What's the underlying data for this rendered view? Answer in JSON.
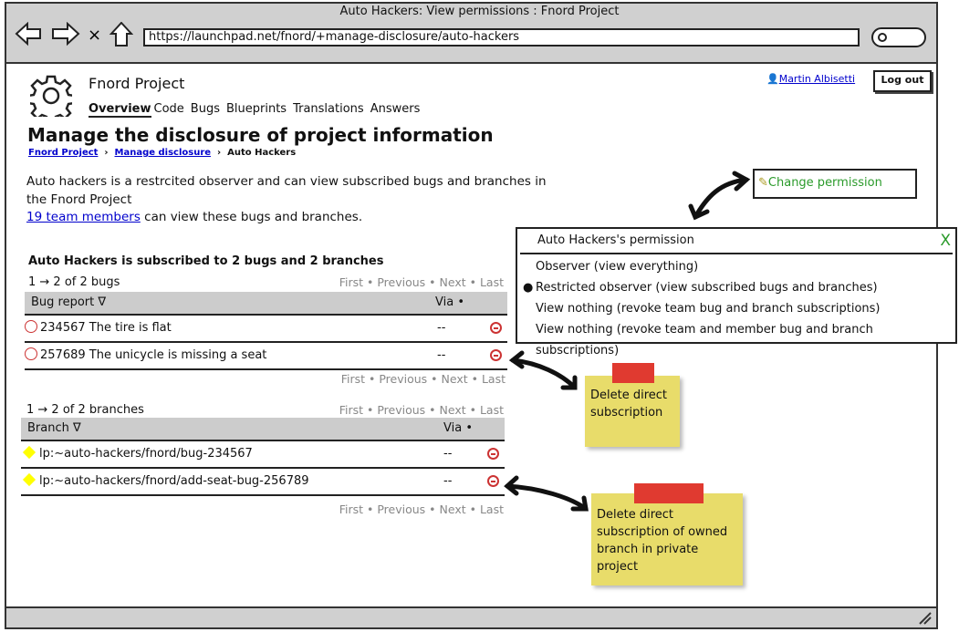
{
  "browser": {
    "title": "Auto Hackers: View permissions : Fnord Project",
    "url": "https://launchpad.net/fnord/+manage-disclosure/auto-hackers",
    "stop": "X"
  },
  "header": {
    "project": "Fnord Project",
    "user": "Martin Albisetti",
    "logout": "Log out",
    "nav": [
      "Overview",
      "Code",
      "Bugs",
      "Blueprints",
      "Translations",
      "Answers"
    ]
  },
  "page": {
    "title": "Manage the disclosure of project information",
    "breadcrumb": [
      "Fnord Project",
      "Manage disclosure",
      "Auto Hackers"
    ],
    "desc1": "Auto hackers is a restrcited observer and can view subscribed bugs and branches in",
    "desc2": "the Fnord Project",
    "members_link": "19 team members",
    "members_rest": " can view these bugs and branches.",
    "change_permission": "Change permission",
    "subs_heading": "Auto Hackers is subscribed to 2 bugs and 2 branches"
  },
  "pager": {
    "first": "First",
    "previous": "Previous",
    "next": "Next",
    "last": "Last",
    "sep": "•"
  },
  "bugs": {
    "count": "1 → 2 of 2 bugs",
    "col1": "Bug report ∇",
    "col2": "Via •",
    "rows": [
      {
        "title": "234567 The tire is flat",
        "via": "--"
      },
      {
        "title": "257689 The unicycle is missing a seat",
        "via": "--"
      }
    ]
  },
  "branches": {
    "count": "1 → 2 of 2 branches",
    "col1": "Branch ∇",
    "col2": "Via •",
    "rows": [
      {
        "title": "lp:~auto-hackers/fnord/bug-234567",
        "via": "--"
      },
      {
        "title": "lp:~auto-hackers/fnord/add-seat-bug-256789",
        "via": "--"
      }
    ]
  },
  "popup": {
    "title": "Auto Hackers's permission",
    "close": "X",
    "options": [
      "Observer (view everything)",
      "Restricted observer (view subscribed bugs and branches)",
      "View nothing (revoke team bug and branch subscriptions)",
      "View nothing (revoke team and member bug and branch subscriptions)"
    ],
    "selected": 1
  },
  "notes": [
    "Delete direct subscription",
    "Delete direct subscription of owned branch in private project"
  ],
  "colors": {
    "link": "#0000cc",
    "accent_green": "#2a9a2a",
    "note": "#e8dc6a",
    "tape": "#e03a30",
    "delete": "#cc3333"
  }
}
